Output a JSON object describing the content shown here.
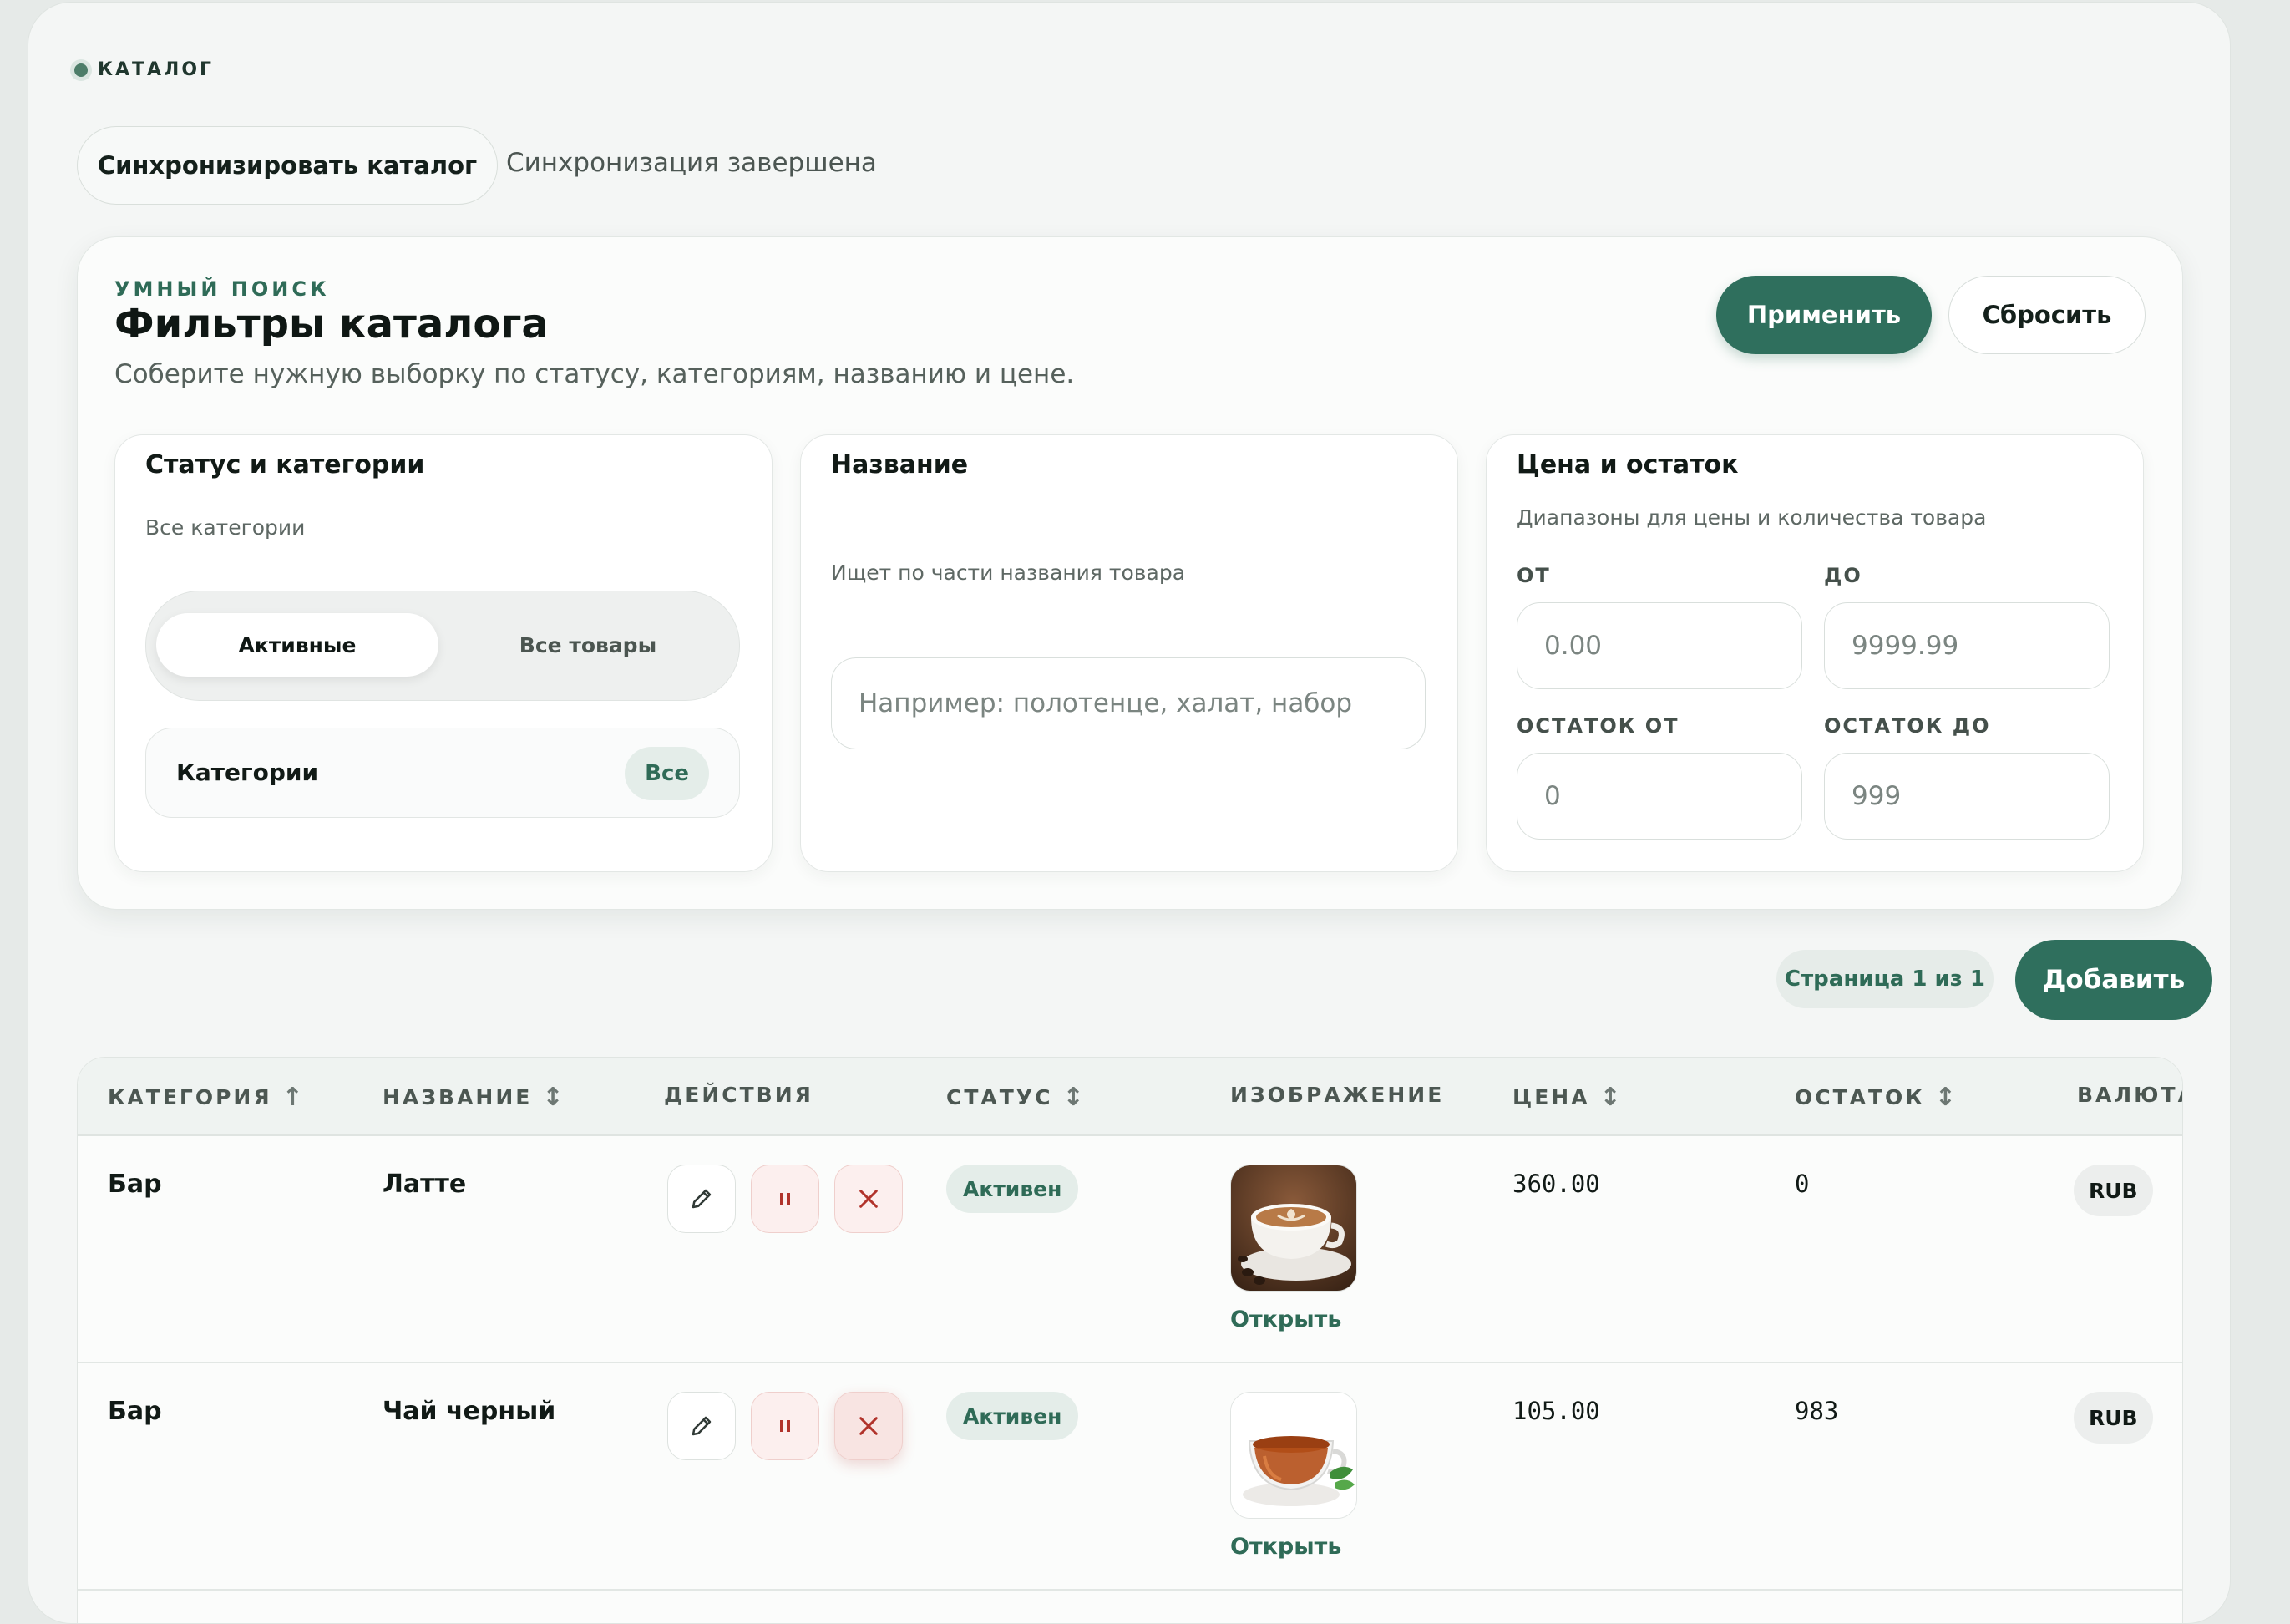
{
  "header": {
    "section_label": "КАТАЛОГ",
    "sync_button_label": "Синхронизировать каталог",
    "sync_status": "Синхронизация завершена"
  },
  "filters": {
    "eyebrow": "УМНЫЙ ПОИСК",
    "title": "Фильтры каталога",
    "description": "Соберите нужную выборку по статусу, категориям, названию и цене.",
    "apply_label": "Применить",
    "reset_label": "Сбросить",
    "status_panel": {
      "title": "Статус и категории",
      "hint": "Все категории",
      "segments": [
        "Активные",
        "Все товары"
      ],
      "selected_segment": "Активные",
      "categories_label": "Категории",
      "categories_value": "Все"
    },
    "name_panel": {
      "title": "Название",
      "hint": "Ищет по части названия товара",
      "placeholder": "Например: полотенце, халат, набор",
      "value": ""
    },
    "price_panel": {
      "title": "Цена и остаток",
      "hint": "Диапазоны для цены и количества товара",
      "price_from_label": "ОТ",
      "price_from_placeholder": "0.00",
      "price_to_label": "ДО",
      "price_to_placeholder": "9999.99",
      "stock_from_label": "ОСТАТОК ОТ",
      "stock_from_placeholder": "0",
      "stock_to_label": "ОСТАТОК ДО",
      "stock_to_placeholder": "999"
    }
  },
  "toolbar": {
    "page_indicator": "Страница 1 из 1",
    "add_label": "Добавить"
  },
  "table": {
    "columns": {
      "category": "КАТЕГОРИЯ",
      "name": "НАЗВАНИЕ",
      "actions": "ДЕЙСТВИЯ",
      "status": "СТАТУС",
      "image": "ИЗОБРАЖЕНИЕ",
      "price": "ЦЕНА",
      "stock": "ОСТАТОК",
      "currency": "ВАЛЮТА"
    },
    "sort_icons": {
      "ascending": "↑",
      "unsorted": "↕"
    },
    "rows": [
      {
        "category": "Бар",
        "name": "Латте",
        "status": "Активен",
        "image_icon": "latte-cup-photo",
        "open_label": "Открыть",
        "price": "360.00",
        "stock": "0",
        "currency": "RUB"
      },
      {
        "category": "Бар",
        "name": "Чай черный",
        "status": "Активен",
        "image_icon": "black-tea-cup-photo",
        "open_label": "Открыть",
        "price": "105.00",
        "stock": "983",
        "currency": "RUB"
      }
    ]
  },
  "colors": {
    "accent": "#2f6f5d",
    "accent_soft": "#e4ede9",
    "danger": "#b1332b",
    "danger_soft": "#fcefee",
    "background": "#e6eae8",
    "surface": "#f4f6f5"
  },
  "icons": {
    "edit": "pencil-icon",
    "pause": "pause-icon",
    "delete": "close-icon",
    "section_dot": "dot-icon"
  }
}
